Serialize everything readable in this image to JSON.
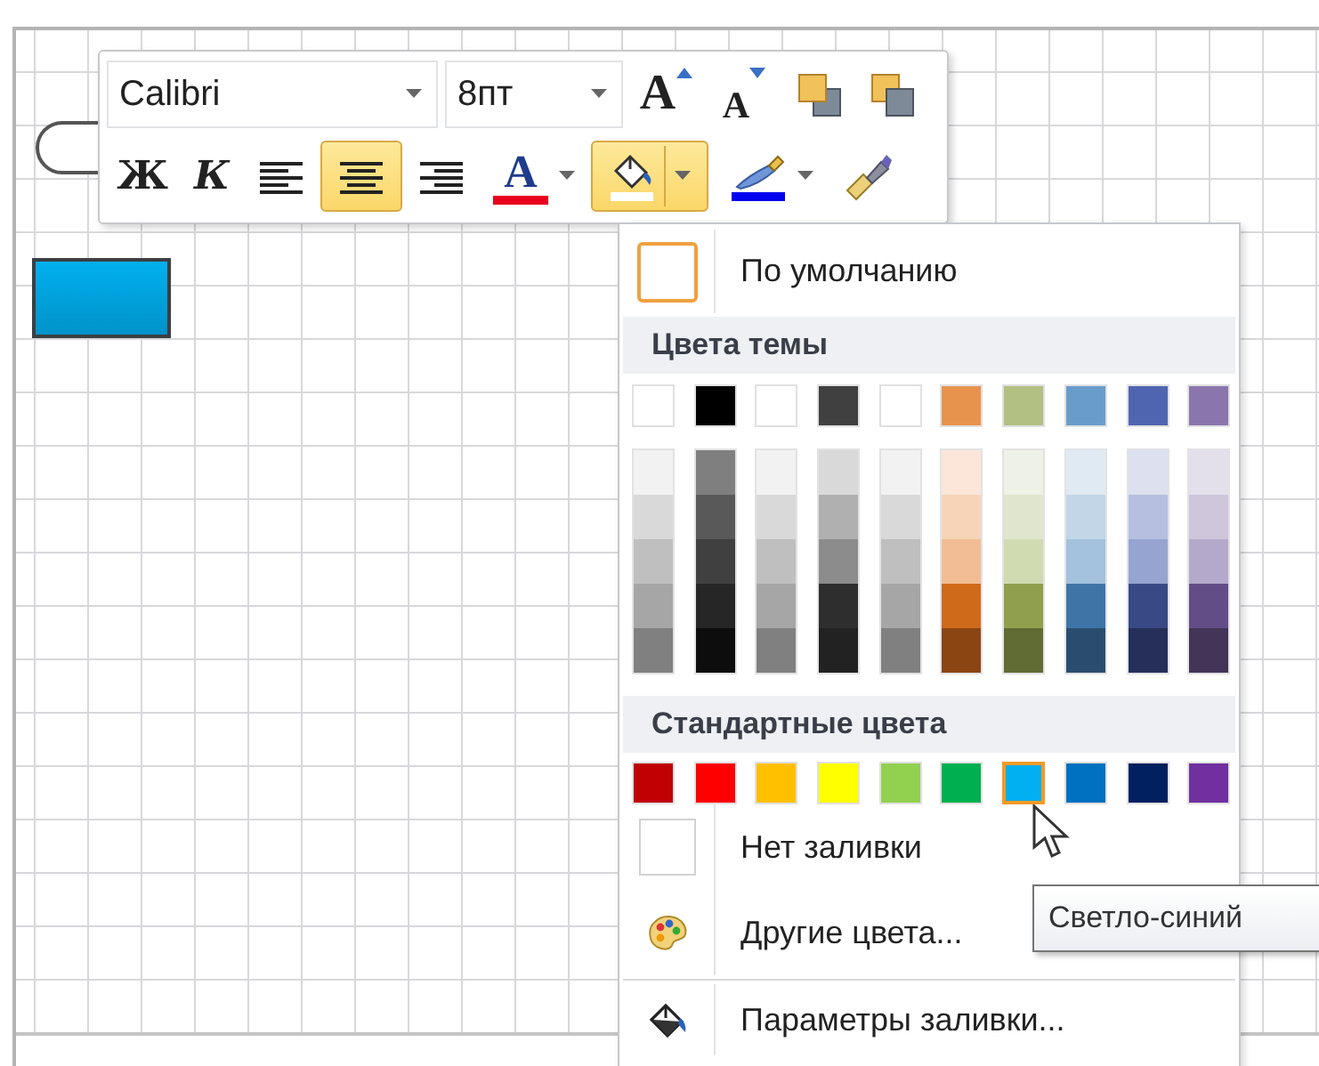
{
  "mini_toolbar": {
    "top_row": [
      {
        "kind": "font_combo",
        "value": "Calibri"
      },
      {
        "kind": "size_combo",
        "value": "8пт"
      },
      {
        "kind": "grow_font",
        "label": "A"
      },
      {
        "kind": "shrink_font",
        "label": "A"
      },
      {
        "kind": "bring_forward"
      },
      {
        "kind": "send_backward"
      }
    ],
    "bottom_row": [
      {
        "kind": "bold",
        "label": "Ж",
        "selected": false
      },
      {
        "kind": "italic",
        "label": "К",
        "selected": false
      },
      {
        "kind": "align_left",
        "selected": false
      },
      {
        "kind": "align_center",
        "selected": true
      },
      {
        "kind": "align_right",
        "selected": false
      },
      {
        "kind": "font_color",
        "label": "A",
        "selected": false
      },
      {
        "kind": "fill_color",
        "selected": true
      },
      {
        "kind": "line_color",
        "selected": false
      },
      {
        "kind": "format_painter",
        "selected": false
      }
    ]
  },
  "fill_menu": {
    "default_item": {
      "label": "По умолчанию",
      "selected": true
    },
    "theme_header": "Цвета темы",
    "theme_colors": [
      {
        "color": "#ffffff",
        "selected": false
      },
      {
        "color": "#000000",
        "selected": false
      },
      {
        "color": "#ffffff",
        "selected": false
      },
      {
        "color": "#404040",
        "selected": false
      },
      {
        "color": "#ffffff",
        "selected": false
      },
      {
        "color": "#e8934d",
        "selected": false
      },
      {
        "color": "#b2c083",
        "selected": false
      },
      {
        "color": "#6a9ccb",
        "selected": false
      },
      {
        "color": "#4f65b0",
        "selected": false
      },
      {
        "color": "#8a76ad",
        "selected": false
      }
    ],
    "theme_shades": [
      {
        "shades": [
          {
            "color": "#f2f2f2"
          },
          {
            "color": "#d9d9d9"
          },
          {
            "color": "#bfbfbf"
          },
          {
            "color": "#a6a6a6"
          },
          {
            "color": "#808080"
          }
        ]
      },
      {
        "shades": [
          {
            "color": "#7f7f7f"
          },
          {
            "color": "#595959"
          },
          {
            "color": "#404040"
          },
          {
            "color": "#262626"
          },
          {
            "color": "#0d0d0d"
          }
        ]
      },
      {
        "shades": [
          {
            "color": "#f2f2f2"
          },
          {
            "color": "#d9d9d9"
          },
          {
            "color": "#bfbfbf"
          },
          {
            "color": "#a6a6a6"
          },
          {
            "color": "#808080"
          }
        ]
      },
      {
        "shades": [
          {
            "color": "#d9d9d9"
          },
          {
            "color": "#b0b0b0"
          },
          {
            "color": "#8c8c8c"
          },
          {
            "color": "#2e2e2e"
          },
          {
            "color": "#222222"
          }
        ]
      },
      {
        "shades": [
          {
            "color": "#f2f2f2"
          },
          {
            "color": "#d9d9d9"
          },
          {
            "color": "#bfbfbf"
          },
          {
            "color": "#a6a6a6"
          },
          {
            "color": "#808080"
          }
        ]
      },
      {
        "shades": [
          {
            "color": "#fbe6d9"
          },
          {
            "color": "#f7d4b7"
          },
          {
            "color": "#f2bd94"
          },
          {
            "color": "#d06a1b"
          },
          {
            "color": "#8b4512"
          }
        ]
      },
      {
        "shades": [
          {
            "color": "#eef1e5"
          },
          {
            "color": "#dfe6cd"
          },
          {
            "color": "#d1dbb1"
          },
          {
            "color": "#8f9f4d"
          },
          {
            "color": "#606c33"
          }
        ]
      },
      {
        "shades": [
          {
            "color": "#e0eaf3"
          },
          {
            "color": "#c2d6e8"
          },
          {
            "color": "#a4c1dd"
          },
          {
            "color": "#3f74a6"
          },
          {
            "color": "#2a4d6f"
          }
        ]
      },
      {
        "shades": [
          {
            "color": "#dce0ef"
          },
          {
            "color": "#b6bfe0"
          },
          {
            "color": "#95a4d0"
          },
          {
            "color": "#384a86"
          },
          {
            "color": "#252f59"
          }
        ]
      },
      {
        "shades": [
          {
            "color": "#e3e0eb"
          },
          {
            "color": "#cfc6dc"
          },
          {
            "color": "#b5a9cb"
          },
          {
            "color": "#634d86"
          },
          {
            "color": "#433458"
          }
        ]
      }
    ],
    "standard_header": "Стандартные цвета",
    "standard_colors": [
      {
        "color": "#c00000",
        "selected": false
      },
      {
        "color": "#ff0000",
        "selected": false
      },
      {
        "color": "#ffc000",
        "selected": false
      },
      {
        "color": "#ffff00",
        "selected": false
      },
      {
        "color": "#92d050",
        "selected": false
      },
      {
        "color": "#00b050",
        "selected": false
      },
      {
        "color": "#00b0f0",
        "selected": true
      },
      {
        "color": "#0070c0",
        "selected": false
      },
      {
        "color": "#002060",
        "selected": false
      },
      {
        "color": "#7030a0",
        "selected": false
      }
    ],
    "items": [
      {
        "kind": "no_fill",
        "label": "Нет заливки"
      },
      {
        "kind": "more_colors",
        "label": "Другие цвета..."
      },
      {
        "kind": "fill_options",
        "label": "Параметры заливки..."
      }
    ]
  },
  "tooltip": "Светло-синий"
}
